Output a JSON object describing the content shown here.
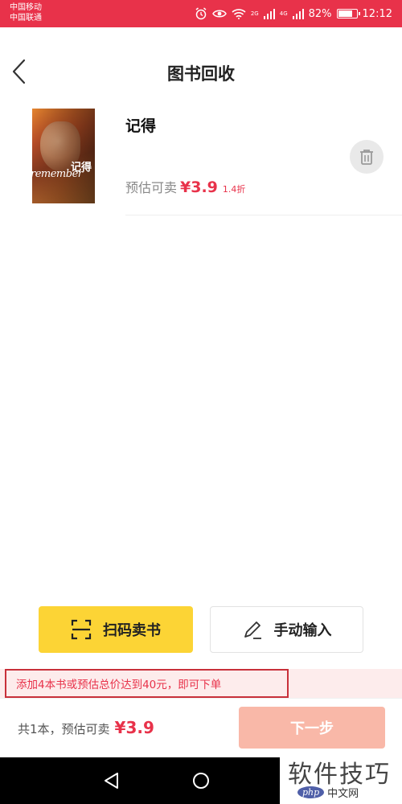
{
  "status_bar": {
    "carrier_1": "中国移动",
    "carrier_2": "中国联通",
    "net_1": "2G",
    "net_2": "4G",
    "battery": "82%",
    "battery_level": 0.82,
    "time": "12:12"
  },
  "header": {
    "title": "图书回收"
  },
  "book": {
    "cover_title": "记得",
    "cover_word": "remember",
    "title": "记得",
    "price_label": "预估可卖",
    "price": "¥3.9",
    "discount": "1.4折"
  },
  "actions": {
    "scan_label": "扫码卖书",
    "manual_label": "手动输入"
  },
  "notice": {
    "text": "添加4本书或预估总价达到40元，即可下单"
  },
  "footer": {
    "total_label": "共1本，预估可卖",
    "total_price": "¥3.9",
    "next_label": "下一步"
  },
  "watermark": {
    "main": "软件技巧",
    "logo_php": "php",
    "logo_cn": "中文网"
  },
  "colors": {
    "accent_red": "#e8324a",
    "scan_yellow": "#fcd435",
    "next_disabled": "#f9b8a8"
  }
}
